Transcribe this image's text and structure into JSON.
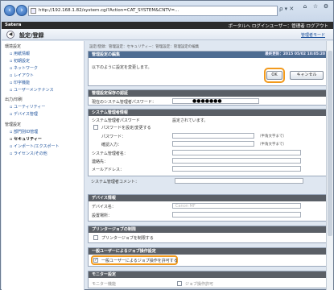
{
  "browser": {
    "url": "http://192.168.1.82/system.cgi?Action=CAT_SYSTEM&CNTV=...",
    "tools": "ρ ▾ ✕",
    "icons": [
      "back-icon",
      "forward-icon",
      "home-icon",
      "star-icon",
      "gear-icon"
    ]
  },
  "app": {
    "brand": "Satera",
    "links": "ポータルへ  ログインユーザー：管理者 ログアウト"
  },
  "title": {
    "text": "設定/登録",
    "right_link": "管理者モード"
  },
  "sidebar": {
    "group1": "環境設定",
    "items1": [
      "▫ 用紙情報",
      "▫ 初期設定",
      "▫ ネットワーク",
      "▫ レイアウト",
      "▫ 印字機能",
      "▫ ユーザーメンテナンス"
    ],
    "group2": "出力/印刷",
    "items2": [
      "▫ ユーティリティー",
      "▫ デバイス管理"
    ],
    "group3": "管理設定",
    "items3": [
      "▫ 部門別ID管理",
      "▫ セキュリティー",
      "▫ インポート/エクスポート",
      "▫ ライセンス/その他"
    ]
  },
  "breadcrumb": "設定/登録：管理設定：セキュリティー：管理設定：管理設定の編集",
  "edit_panel": {
    "title": "管理設定の編集",
    "updated": "最終更新：2015 05/02 10:05:20",
    "message": "以下のように設定を変更します。",
    "ok": "OK",
    "cancel": "キャンセル"
  },
  "auth": {
    "title": "管理設定保存の認証",
    "label": "現在のシステム管理者パスワード：",
    "value": "●●●●●●●"
  },
  "sysadmin": {
    "title": "システム管理者情報",
    "pw_label": "システム管理者パスワード",
    "pw_status": "設定されています。",
    "change_pw": "パスワードを設定/変更する",
    "password": "パスワード：",
    "confirm": "確認入力：",
    "hint1": "（半角文字まで）",
    "hint2": "（半角文字まで）",
    "name": "システム管理者名：",
    "contact": "連絡先：",
    "email": "メールアドレス：",
    "comment": "システム管理者コメント："
  },
  "device": {
    "title": "デバイス情報",
    "name": "デバイス名：",
    "name_value": "Canon MF",
    "location": "設置場所："
  },
  "printer_jobs": {
    "title": "プリンタージョブの制限",
    "restrict": "プリンタージョブを制限する"
  },
  "general_user": {
    "title": "一般ユーザーによるジョブ操作設定",
    "option": "一般ユーザーによるジョブ操作を許可する"
  },
  "remote": {
    "title": "モニター設定",
    "a": "モニター機能",
    "b": "ジョブ操作許可"
  }
}
